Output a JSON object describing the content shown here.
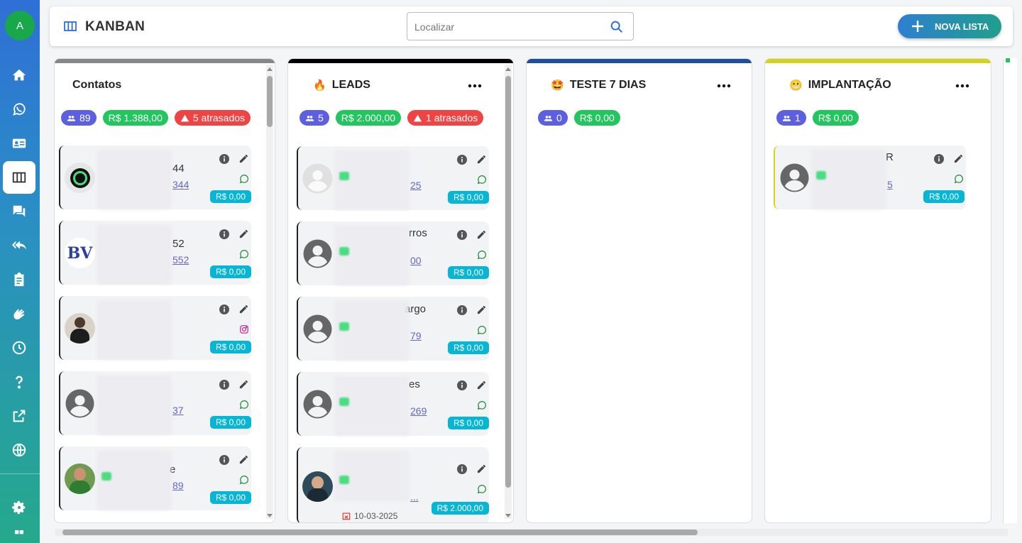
{
  "app": {
    "user_initial": "A"
  },
  "sidebar": {
    "items": [
      {
        "name": "home-icon"
      },
      {
        "name": "whatsapp-icon"
      },
      {
        "name": "contact-card-icon"
      },
      {
        "name": "kanban-icon",
        "active": true
      },
      {
        "name": "chat-icon"
      },
      {
        "name": "reply-all-icon"
      },
      {
        "name": "clipboard-icon"
      },
      {
        "name": "clap-icon"
      },
      {
        "name": "clock-icon"
      },
      {
        "name": "help-icon"
      },
      {
        "name": "external-link-icon"
      },
      {
        "name": "globe-icon"
      },
      {
        "name": "settings-icon"
      }
    ]
  },
  "header": {
    "title": "KANBAN",
    "search_placeholder": "Localizar",
    "new_list_label": "NOVA LISTA"
  },
  "columns": [
    {
      "title": "Contatos",
      "emoji": "",
      "accent": "#888888",
      "count": "89",
      "total": "R$ 1.388,00",
      "late": "5 atrasados",
      "cards": [
        {
          "name_tail": "44",
          "phone_tail": "344",
          "value": "R$ 0,00",
          "channel": "whatsapp"
        },
        {
          "name_tail": "52",
          "phone_tail": "552",
          "value": "R$ 0,00",
          "channel": "whatsapp"
        },
        {
          "name_tail": "",
          "phone_tail": "",
          "value": "R$ 0,00",
          "channel": "instagram"
        },
        {
          "name_tail": "",
          "phone_tail": "37",
          "value": "R$ 0,00",
          "channel": "whatsapp"
        },
        {
          "name_tail": "e",
          "phone_tail": "89",
          "value": "R$ 0,00",
          "channel": "whatsapp"
        }
      ]
    },
    {
      "title": "LEADS",
      "emoji": "🔥",
      "accent": "#000000",
      "count": "5",
      "total": "R$ 2.000,00",
      "late": "1 atrasados",
      "cards": [
        {
          "name_tail": "",
          "phone_tail": "25",
          "value": "R$ 0,00",
          "channel": "whatsapp"
        },
        {
          "name_tail": "rros",
          "phone_tail": "00",
          "value": "R$ 0,00",
          "channel": "whatsapp"
        },
        {
          "name_tail": "argo",
          "phone_tail": "79",
          "value": "R$ 0,00",
          "channel": "whatsapp"
        },
        {
          "name_tail": "es",
          "phone_tail": "269",
          "value": "R$ 0,00",
          "channel": "whatsapp"
        },
        {
          "name_tail": "",
          "phone_tail": "...",
          "value": "R$ 2.000,00",
          "channel": "whatsapp",
          "date": "10-03-2025"
        }
      ]
    },
    {
      "title": "TESTE 7 DIAS",
      "emoji": "🤩",
      "accent": "#1e4e9e",
      "count": "0",
      "total": "R$ 0,00",
      "late": "",
      "cards": []
    },
    {
      "title": "IMPLANTAÇÃO",
      "emoji": "😬",
      "accent": "#d6d21c",
      "count": "1",
      "total": "R$ 0,00",
      "late": "",
      "cards": [
        {
          "name_tail": "R",
          "phone_tail": "5",
          "value": "R$ 0,00",
          "channel": "whatsapp"
        }
      ]
    }
  ]
}
